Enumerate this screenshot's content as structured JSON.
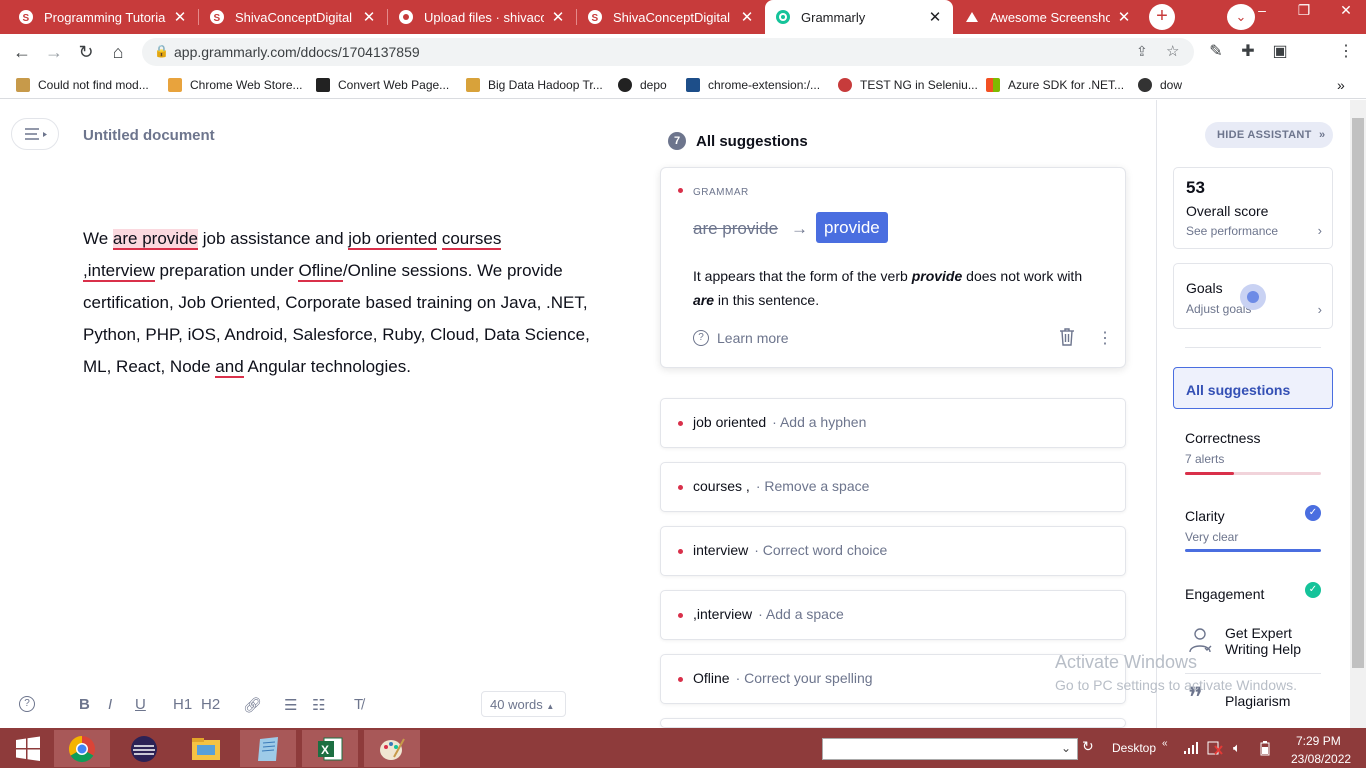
{
  "browser": {
    "tabs": [
      {
        "title": "Programming Tutorials",
        "active": false
      },
      {
        "title": "ShivaConceptDigital",
        "active": false
      },
      {
        "title": "Upload files · shivaconc",
        "active": false
      },
      {
        "title": "ShivaConceptDigital",
        "active": false
      },
      {
        "title": "Grammarly",
        "active": true
      },
      {
        "title": "Awesome Screenshot a",
        "active": false
      }
    ],
    "url": "app.grammarly.com/ddocs/1704137859",
    "bookmarks": [
      "Could not find mod...",
      "Chrome Web Store...",
      "Convert Web Page...",
      "Big Data Hadoop Tr...",
      "depo",
      "chrome-extension:/...",
      "TEST NG in Seleniu...",
      "Azure SDK for .NET...",
      "dow"
    ]
  },
  "document": {
    "title": "Untitled document",
    "word_count": "40 words",
    "text": {
      "p1": "We ",
      "e1": "are provide",
      "p2": " job assistance and ",
      "e2": "job oriented",
      "p3": " ",
      "e3": "courses ",
      "p4": " ",
      "e4": ",interview",
      "p5": " preparation under ",
      "e5": "Ofline",
      "p6": "/Online sessions. We provide certification, Job Oriented, Corporate based training on Java, .NET, Python, PHP, iOS, Android, Salesforce, Ruby, Cloud, Data Science, ML, React, Node ",
      "e6": "and",
      "p7": " Angular technologies."
    },
    "toolbar": [
      "B",
      "I",
      "U",
      "H1",
      "H2"
    ]
  },
  "suggestions": {
    "count": "7",
    "heading": "All suggestions",
    "main": {
      "category": "GRAMMAR",
      "original": "are provide",
      "arrow": "→",
      "replacement": "provide",
      "explanation_a": "It appears that the form of the verb ",
      "explanation_b": "provide",
      "explanation_c": " does not work with ",
      "explanation_d": "are",
      "explanation_e": " in this sentence.",
      "learn_more": "Learn more"
    },
    "cards": [
      {
        "word": "job oriented",
        "desc": "· Add a hyphen"
      },
      {
        "word": "courses ,",
        "desc": "· Remove a space"
      },
      {
        "word": "interview",
        "desc": "· Correct word choice"
      },
      {
        "word": ",interview",
        "desc": "· Add a space"
      },
      {
        "word": "Ofline",
        "desc": "· Correct your spelling"
      }
    ]
  },
  "assistant": {
    "hide_label": "HIDE ASSISTANT",
    "score": "53",
    "score_label": "Overall score",
    "score_link": "See performance",
    "goals": "Goals",
    "goals_link": "Adjust goals",
    "all_suggestions": "All suggestions",
    "correctness": "Correctness",
    "correctness_sub": "7 alerts",
    "clarity": "Clarity",
    "clarity_sub": "Very clear",
    "engagement": "Engagement",
    "expert_a": "Get Expert",
    "expert_b": "Writing Help",
    "plagiarism": "Plagiarism",
    "colors": {
      "accent": "#4a6ee0",
      "error": "#d9304a",
      "success": "#15c39a"
    }
  },
  "watermark": {
    "line1": "Activate Windows",
    "line2": "Go to PC settings to activate Windows."
  },
  "taskbar": {
    "desktop": "Desktop",
    "time": "7:29 PM",
    "date": "23/08/2022"
  }
}
